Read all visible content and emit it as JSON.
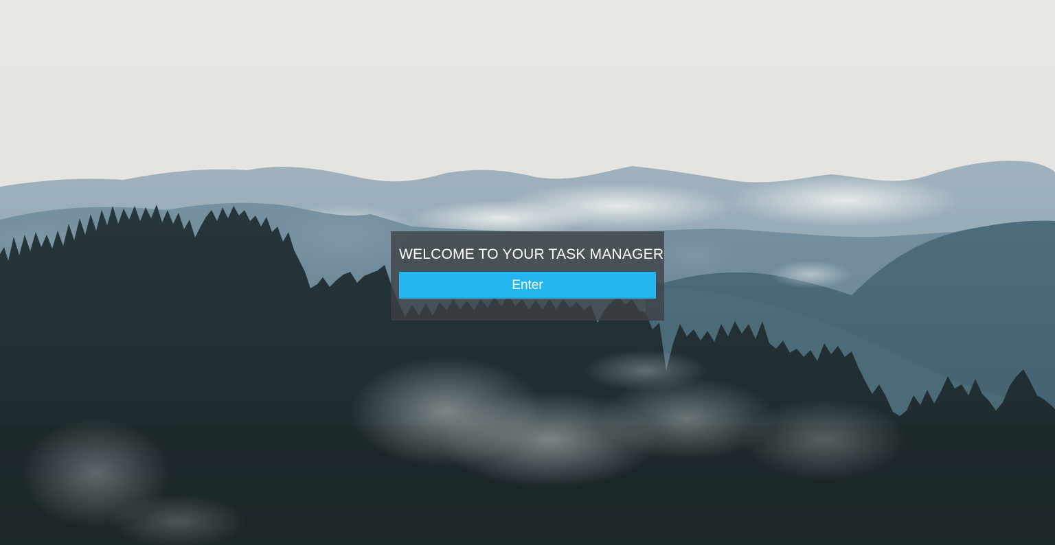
{
  "welcome": {
    "title": "WELCOME TO YOUR TASK MANAGER",
    "enter_label": "Enter"
  },
  "colors": {
    "accent": "#23b5ee",
    "panel": "#3c4042",
    "sky": "#e6e5e1",
    "forest": "#1d2a2e"
  },
  "background": {
    "scene": "misty-mountain-forest"
  }
}
